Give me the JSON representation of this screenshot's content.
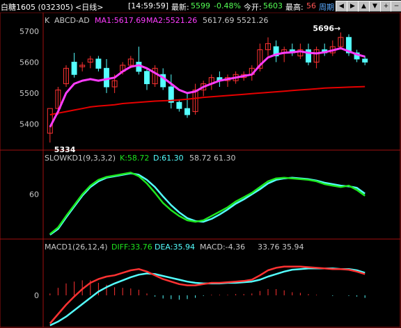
{
  "topbar": {
    "symbol": "白糖1605 (032305)",
    "period_tag": "<日线>",
    "time": "[14:59:59]",
    "latest_label": "最新:",
    "latest_value": "5599",
    "change_pct": "-0.48%",
    "open_label": "今开:",
    "open_value": "5603",
    "high_label": "最高:",
    "high_value": "56",
    "period_button": "周期",
    "nav_icons": [
      "arrow-left-icon",
      "arrow-right-icon",
      "arrow-up-icon",
      "arrow-down-icon",
      "zoom-in-icon",
      "zoom-out-icon"
    ]
  },
  "colors": {
    "up": "#ff3232",
    "down": "#54ffff",
    "ma1": "#ff3cff",
    "ma2": "#e60000",
    "green": "#1ee61e",
    "frame": "#a01010",
    "text": "#c8c8c8"
  },
  "chart_data": [
    {
      "type": "candlestick",
      "title": "ABCD-AD",
      "legend": {
        "ma1": "MA1:5617.69",
        "ma2": "MA2:5521.26",
        "values": "5617.69  5521.26",
        "prefix": "K"
      },
      "y_ticks": [
        "5700",
        "5600",
        "5500",
        "5400"
      ],
      "ylim": [
        5320,
        5720
      ],
      "annotations": {
        "high": "5696",
        "low": "5334"
      },
      "candles": [
        {
          "o": 5370,
          "h": 5390,
          "l": 5340,
          "c": 5450
        },
        {
          "o": 5450,
          "h": 5520,
          "l": 5430,
          "c": 5510
        },
        {
          "o": 5530,
          "h": 5590,
          "l": 5520,
          "c": 5580
        },
        {
          "o": 5600,
          "h": 5630,
          "l": 5550,
          "c": 5560
        },
        {
          "o": 5585,
          "h": 5600,
          "l": 5570,
          "c": 5590
        },
        {
          "o": 5600,
          "h": 5620,
          "l": 5580,
          "c": 5610
        },
        {
          "o": 5610,
          "h": 5620,
          "l": 5570,
          "c": 5580
        },
        {
          "o": 5580,
          "h": 5610,
          "l": 5500,
          "c": 5520
        },
        {
          "o": 5520,
          "h": 5560,
          "l": 5500,
          "c": 5540
        },
        {
          "o": 5570,
          "h": 5600,
          "l": 5560,
          "c": 5590
        },
        {
          "o": 5590,
          "h": 5620,
          "l": 5580,
          "c": 5610
        },
        {
          "o": 5600,
          "h": 5650,
          "l": 5560,
          "c": 5570
        },
        {
          "o": 5570,
          "h": 5580,
          "l": 5510,
          "c": 5530
        },
        {
          "o": 5530,
          "h": 5590,
          "l": 5520,
          "c": 5580
        },
        {
          "o": 5560,
          "h": 5580,
          "l": 5510,
          "c": 5520
        },
        {
          "o": 5520,
          "h": 5560,
          "l": 5450,
          "c": 5470
        },
        {
          "o": 5470,
          "h": 5480,
          "l": 5440,
          "c": 5450
        },
        {
          "o": 5450,
          "h": 5500,
          "l": 5420,
          "c": 5430
        },
        {
          "o": 5440,
          "h": 5530,
          "l": 5430,
          "c": 5510
        },
        {
          "o": 5510,
          "h": 5540,
          "l": 5490,
          "c": 5530
        },
        {
          "o": 5530,
          "h": 5560,
          "l": 5510,
          "c": 5550
        },
        {
          "o": 5550,
          "h": 5570,
          "l": 5520,
          "c": 5540
        },
        {
          "o": 5540,
          "h": 5560,
          "l": 5520,
          "c": 5550
        },
        {
          "o": 5540,
          "h": 5570,
          "l": 5530,
          "c": 5560
        },
        {
          "o": 5550,
          "h": 5570,
          "l": 5540,
          "c": 5560
        },
        {
          "o": 5560,
          "h": 5590,
          "l": 5540,
          "c": 5580
        },
        {
          "o": 5580,
          "h": 5660,
          "l": 5570,
          "c": 5640
        },
        {
          "o": 5640,
          "h": 5680,
          "l": 5620,
          "c": 5660
        },
        {
          "o": 5650,
          "h": 5670,
          "l": 5600,
          "c": 5620
        },
        {
          "o": 5630,
          "h": 5650,
          "l": 5600,
          "c": 5640
        },
        {
          "o": 5640,
          "h": 5660,
          "l": 5620,
          "c": 5630
        },
        {
          "o": 5620,
          "h": 5660,
          "l": 5610,
          "c": 5640
        },
        {
          "o": 5640,
          "h": 5660,
          "l": 5590,
          "c": 5600
        },
        {
          "o": 5600,
          "h": 5650,
          "l": 5580,
          "c": 5640
        },
        {
          "o": 5640,
          "h": 5660,
          "l": 5620,
          "c": 5630
        },
        {
          "o": 5630,
          "h": 5670,
          "l": 5620,
          "c": 5650
        },
        {
          "o": 5650,
          "h": 5696,
          "l": 5640,
          "c": 5680
        },
        {
          "o": 5680,
          "h": 5690,
          "l": 5620,
          "c": 5630
        },
        {
          "o": 5630,
          "h": 5640,
          "l": 5600,
          "c": 5610
        },
        {
          "o": 5610,
          "h": 5620,
          "l": 5590,
          "c": 5600
        }
      ],
      "ma1": [
        5390,
        5440,
        5500,
        5530,
        5540,
        5545,
        5540,
        5545,
        5550,
        5570,
        5585,
        5590,
        5580,
        5565,
        5550,
        5530,
        5510,
        5500,
        5505,
        5520,
        5530,
        5540,
        5545,
        5550,
        5555,
        5560,
        5590,
        5615,
        5625,
        5630,
        5632,
        5635,
        5630,
        5628,
        5632,
        5638,
        5645,
        5635,
        5625,
        5618
      ],
      "ma2": [
        5430,
        5435,
        5440,
        5445,
        5450,
        5455,
        5458,
        5460,
        5462,
        5466,
        5468,
        5470,
        5472,
        5474,
        5475,
        5476,
        5478,
        5480,
        5483,
        5486,
        5488,
        5490,
        5492,
        5494,
        5496,
        5498,
        5500,
        5502,
        5504,
        5506,
        5508,
        5510,
        5512,
        5514,
        5516,
        5517,
        5518,
        5519,
        5520,
        5521
      ]
    },
    {
      "type": "line",
      "title": "SLOWKD1(9,3,3,2)",
      "legend": {
        "k": "K:58.72",
        "d": "D:61.30",
        "values": "58.72  61.30"
      },
      "y_ticks": [
        "60"
      ],
      "ylim": [
        0,
        100
      ],
      "series": [
        {
          "name": "K",
          "values": [
            5,
            14,
            30,
            45,
            60,
            72,
            80,
            84,
            86,
            88,
            90,
            85,
            75,
            62,
            48,
            38,
            30,
            24,
            22,
            24,
            30,
            36,
            42,
            50,
            56,
            62,
            70,
            78,
            82,
            83,
            82,
            81,
            80,
            78,
            74,
            72,
            70,
            72,
            66,
            58
          ]
        },
        {
          "name": "D",
          "values": [
            4,
            12,
            28,
            43,
            58,
            70,
            78,
            83,
            85,
            87,
            89,
            87,
            80,
            70,
            57,
            45,
            35,
            27,
            23,
            22,
            26,
            32,
            39,
            47,
            53,
            60,
            67,
            75,
            80,
            82,
            83,
            82,
            81,
            79,
            76,
            74,
            72,
            71,
            69,
            61
          ]
        }
      ]
    },
    {
      "type": "line",
      "title": "MACD1(26,12,4)",
      "legend": {
        "diff": "DIFF:33.76",
        "dea": "DEA:35.94",
        "macd": "MACD:-4.36",
        "values": "33.76  35.94"
      },
      "y_ticks": [
        "0"
      ],
      "ylim": [
        -50,
        70
      ],
      "series": [
        {
          "name": "DIFF",
          "values": [
            -45,
            -30,
            -15,
            -2,
            10,
            20,
            26,
            30,
            32,
            36,
            40,
            42,
            38,
            32,
            26,
            22,
            18,
            16,
            16,
            18,
            20,
            20,
            21,
            22,
            23,
            25,
            32,
            40,
            44,
            46,
            46,
            46,
            45,
            44,
            43,
            42,
            42,
            41,
            38,
            34
          ]
        },
        {
          "name": "DEA",
          "values": [
            -48,
            -42,
            -34,
            -24,
            -14,
            -4,
            6,
            13,
            19,
            24,
            29,
            33,
            35,
            34,
            31,
            28,
            25,
            22,
            20,
            19,
            19,
            19,
            20,
            20,
            21,
            22,
            25,
            30,
            34,
            38,
            41,
            42,
            43,
            43,
            43,
            43,
            42,
            42,
            40,
            36
          ]
        }
      ],
      "bars": [
        3,
        12,
        19,
        22,
        24,
        24,
        20,
        17,
        13,
        12,
        11,
        9,
        3,
        -2,
        -5,
        -6,
        -7,
        -6,
        -4,
        -1,
        1,
        1,
        1,
        2,
        2,
        3,
        7,
        10,
        10,
        8,
        5,
        4,
        2,
        1,
        0,
        -1,
        0,
        -1,
        -2,
        -4
      ]
    }
  ]
}
